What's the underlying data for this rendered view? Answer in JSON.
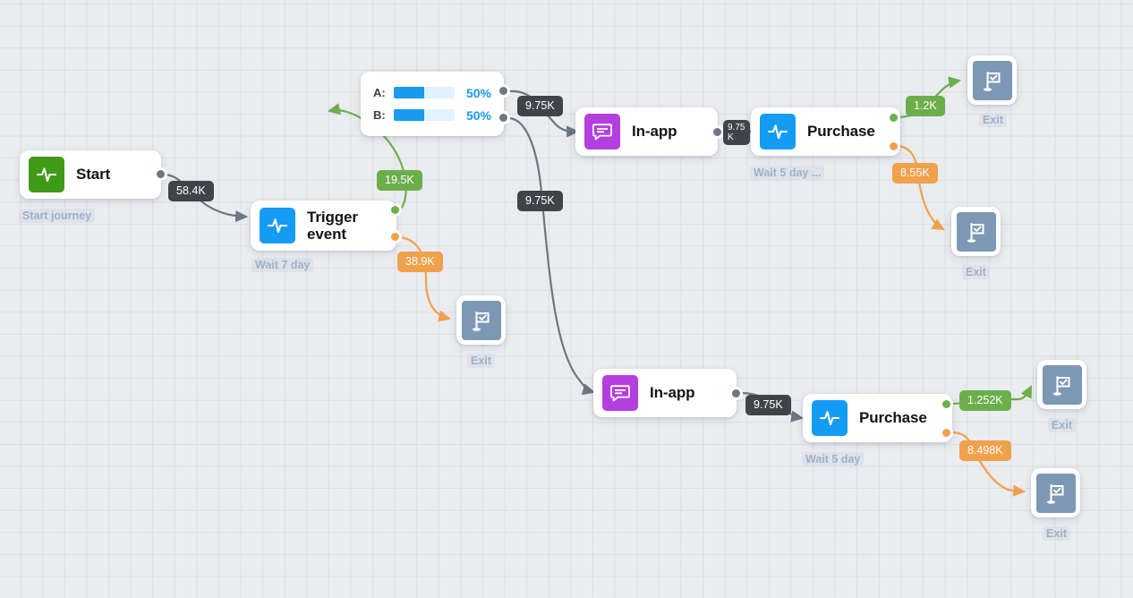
{
  "canvas": {
    "background_color": "#eaecf0",
    "grid_color": "#babec5"
  },
  "palette": {
    "start_green": "#3f9a18",
    "event_blue": "#149cf4",
    "inapp_purple": "#b43fe0",
    "exit_slate": "#7d98b5",
    "badge_dark": "#414349",
    "badge_green": "#6cae4c",
    "badge_amber": "#f0a14c",
    "edge_grey": "#6b7784",
    "edge_green": "#6cae4c",
    "edge_amber": "#f0a14c",
    "split_blue": "#189aef"
  },
  "nodes": {
    "start": {
      "title": "Start",
      "icon": "pulse-icon",
      "sublabel": "Start journey"
    },
    "trigger_event": {
      "title": "Trigger\nevent",
      "icon": "pulse-icon",
      "sublabel": "Wait 7 day"
    },
    "split": {
      "icon": "ab-split-icon",
      "rows": [
        {
          "label": "A:",
          "percent": "50%",
          "fill": 50
        },
        {
          "label": "B:",
          "percent": "50%",
          "fill": 50
        }
      ]
    },
    "inapp_top": {
      "title": "In-app",
      "icon": "message-icon"
    },
    "purchase_top": {
      "title": "Purchase",
      "icon": "pulse-icon",
      "sublabel": "Wait 5 day ..."
    },
    "inapp_bottom": {
      "title": "In-app",
      "icon": "message-icon"
    },
    "purchase_bottom": {
      "title": "Purchase",
      "icon": "pulse-icon",
      "sublabel": "Wait 5 day"
    },
    "exit_1": {
      "label": "Exit",
      "icon": "flag-check-icon"
    },
    "exit_2": {
      "label": "Exit",
      "icon": "flag-check-icon"
    },
    "exit_3": {
      "label": "Exit",
      "icon": "flag-check-icon"
    },
    "exit_4": {
      "label": "Exit",
      "icon": "flag-check-icon"
    },
    "exit_5": {
      "label": "Exit",
      "icon": "flag-check-icon"
    }
  },
  "edges": [
    {
      "id": "start-to-trigger",
      "value": "58.4K",
      "color": "dark"
    },
    {
      "id": "trigger-green-to-split",
      "value": "19.5K",
      "color": "green"
    },
    {
      "id": "trigger-amber-to-exit",
      "value": "38.9K",
      "color": "amber"
    },
    {
      "id": "split-a-to-inapp-top",
      "value": "9.75K",
      "color": "dark"
    },
    {
      "id": "split-b-to-inapp-bottom",
      "value": "9.75K",
      "color": "dark"
    },
    {
      "id": "inapp-top-to-purchase-top",
      "value": "9.75 K",
      "color": "dark"
    },
    {
      "id": "purchase-top-green-to-exit",
      "value": "1.2K",
      "color": "green"
    },
    {
      "id": "purchase-top-amber-to-exit",
      "value": "8.55K",
      "color": "amber"
    },
    {
      "id": "inapp-bottom-to-purchase-bottom",
      "value": "9.75K",
      "color": "dark"
    },
    {
      "id": "purchase-bottom-green-to-exit",
      "value": "1.252K",
      "color": "green"
    },
    {
      "id": "purchase-bottom-amber-to-exit",
      "value": "8.498K",
      "color": "amber"
    }
  ]
}
